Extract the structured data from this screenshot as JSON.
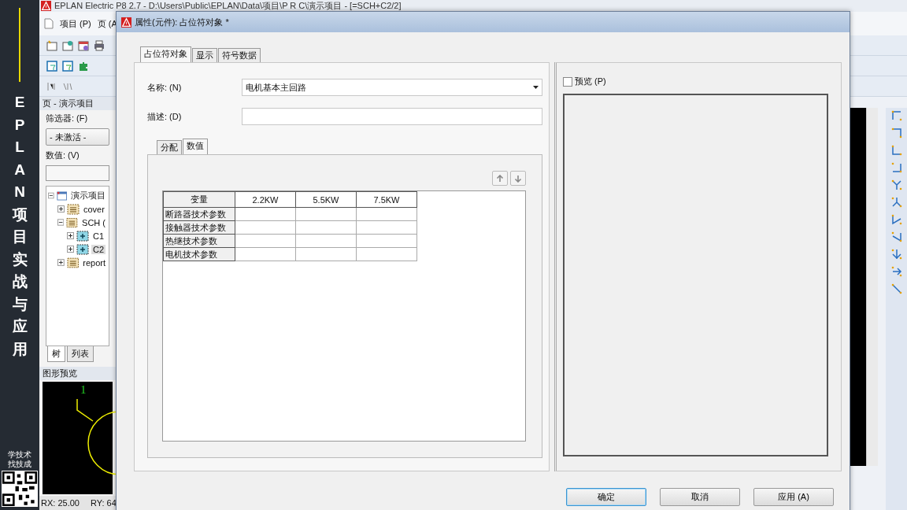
{
  "banner": {
    "title": "EPLAN项目实战与应用",
    "slogan": [
      "学技术",
      "找技成"
    ]
  },
  "app": {
    "title": "EPLAN Electric P8 2.7 - D:\\Users\\Public\\EPLAN\\Data\\项目\\P R C\\演示项目 - [=SCH+C2/2]",
    "menu": [
      "项目 (P)",
      "页 (A"
    ],
    "page_panel": {
      "title": "页 - 演示项目",
      "filter_label": "筛选器: (F)",
      "filter_value": "- 未激活 -",
      "value_label": "数值: (V)",
      "tree": [
        {
          "label": "演示项目",
          "expanded": true,
          "selected": false,
          "kind": "project",
          "children": [
            {
              "label": "cover",
              "expanded": false,
              "selected": false,
              "kind": "folder"
            },
            {
              "label": "SCH (",
              "expanded": true,
              "selected": false,
              "kind": "folder",
              "children": [
                {
                  "label": "C1",
                  "expanded": false,
                  "selected": false,
                  "kind": "page"
                },
                {
                  "label": "C2",
                  "expanded": false,
                  "selected": true,
                  "kind": "page"
                }
              ]
            },
            {
              "label": "report",
              "expanded": false,
              "selected": false,
              "kind": "folder"
            }
          ]
        }
      ],
      "tabs": [
        {
          "label": "树",
          "selected": true
        },
        {
          "label": "列表",
          "selected": false
        }
      ]
    },
    "preview_panel": {
      "title": "图形预览",
      "marker": "1"
    },
    "status_bar": [
      "RX: 25.00",
      "RY: 64"
    ]
  },
  "dialog": {
    "title": "属性(元件): 占位符对象 *",
    "tabs": [
      {
        "label": "占位符对象",
        "selected": true
      },
      {
        "label": "显示",
        "selected": false
      },
      {
        "label": "符号数据",
        "selected": false
      }
    ],
    "name_label": "名称: (N)",
    "name_value": "电机基本主回路",
    "description_label": "描述: (D)",
    "sub_tabs": [
      {
        "label": "分配",
        "selected": false
      },
      {
        "label": "数值",
        "selected": true
      }
    ],
    "table": {
      "columns": [
        "变量",
        "2.2KW",
        "5.5KW",
        "7.5KW"
      ],
      "rows": [
        {
          "label": "断路器技术参数"
        },
        {
          "label": "接触器技术参数"
        },
        {
          "label": "热继技术参数"
        },
        {
          "label": "电机技术参数"
        }
      ]
    },
    "preview": {
      "label": "预览 (P)",
      "checked": false
    },
    "buttons": [
      {
        "label": "确定",
        "kind": "default"
      },
      {
        "label": "取消",
        "kind": "normal"
      },
      {
        "label": "应用 (A)",
        "kind": "normal"
      }
    ]
  }
}
